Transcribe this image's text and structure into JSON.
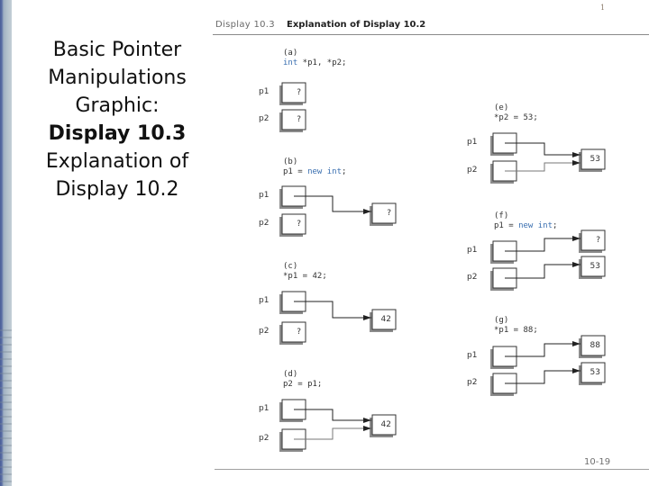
{
  "slide": {
    "title_lines": [
      {
        "text": "Basic Pointer",
        "bold": false
      },
      {
        "text": "Manipulations",
        "bold": false
      },
      {
        "text": "Graphic:",
        "bold": false
      },
      {
        "text": "Display 10.3",
        "bold": true
      },
      {
        "text": "Explanation of",
        "bold": false
      },
      {
        "text": "Display 10.2",
        "bold": false
      }
    ],
    "page_corner": "1",
    "footer_page": "10-19"
  },
  "display_header": {
    "number": "Display 10.3",
    "title": "Explanation of Display 10.2"
  },
  "colors": {
    "sidebar": "#5a6ea5",
    "keyword": "#3a6fb0",
    "box_shadow": "#8c8c8c"
  },
  "steps": [
    {
      "id": "a",
      "label": "(a)",
      "code": [
        {
          "t": "int",
          "kw": true
        },
        {
          "t": " *p1, *p2;",
          "kw": false
        }
      ],
      "vars": [
        {
          "name": "p1",
          "value": "?"
        },
        {
          "name": "p2",
          "value": "?"
        }
      ],
      "targets": []
    },
    {
      "id": "b",
      "label": "(b)",
      "code": [
        {
          "t": "p1 = ",
          "kw": false
        },
        {
          "t": "new int",
          "kw": true
        },
        {
          "t": ";",
          "kw": false
        }
      ],
      "vars": [
        {
          "name": "p1",
          "value": ""
        },
        {
          "name": "p2",
          "value": "?"
        }
      ],
      "targets": [
        {
          "value": "?",
          "from": [
            "p1"
          ]
        }
      ]
    },
    {
      "id": "c",
      "label": "(c)",
      "code": [
        {
          "t": "*p1 = 42;",
          "kw": false
        }
      ],
      "vars": [
        {
          "name": "p1",
          "value": ""
        },
        {
          "name": "p2",
          "value": "?"
        }
      ],
      "targets": [
        {
          "value": "42",
          "from": [
            "p1"
          ]
        }
      ]
    },
    {
      "id": "d",
      "label": "(d)",
      "code": [
        {
          "t": "p2 = p1;",
          "kw": false
        }
      ],
      "vars": [
        {
          "name": "p1",
          "value": ""
        },
        {
          "name": "p2",
          "value": ""
        }
      ],
      "targets": [
        {
          "value": "42",
          "from": [
            "p1",
            "p2"
          ]
        }
      ]
    },
    {
      "id": "e",
      "label": "(e)",
      "code": [
        {
          "t": "*p2 = 53;",
          "kw": false
        }
      ],
      "vars": [
        {
          "name": "p1",
          "value": ""
        },
        {
          "name": "p2",
          "value": ""
        }
      ],
      "targets": [
        {
          "value": "53",
          "from": [
            "p1",
            "p2"
          ]
        }
      ]
    },
    {
      "id": "f",
      "label": "(f)",
      "code": [
        {
          "t": "p1 = ",
          "kw": false
        },
        {
          "t": "new int",
          "kw": true
        },
        {
          "t": ";",
          "kw": false
        }
      ],
      "vars": [
        {
          "name": "p1",
          "value": ""
        },
        {
          "name": "p2",
          "value": ""
        }
      ],
      "targets": [
        {
          "value": "?",
          "from": [
            "p1"
          ]
        },
        {
          "value": "53",
          "from": [
            "p2"
          ]
        }
      ]
    },
    {
      "id": "g",
      "label": "(g)",
      "code": [
        {
          "t": "*p1 = 88;",
          "kw": false
        }
      ],
      "vars": [
        {
          "name": "p1",
          "value": ""
        },
        {
          "name": "p2",
          "value": ""
        }
      ],
      "targets": [
        {
          "value": "88",
          "from": [
            "p1"
          ]
        },
        {
          "value": "53",
          "from": [
            "p2"
          ]
        }
      ]
    }
  ]
}
